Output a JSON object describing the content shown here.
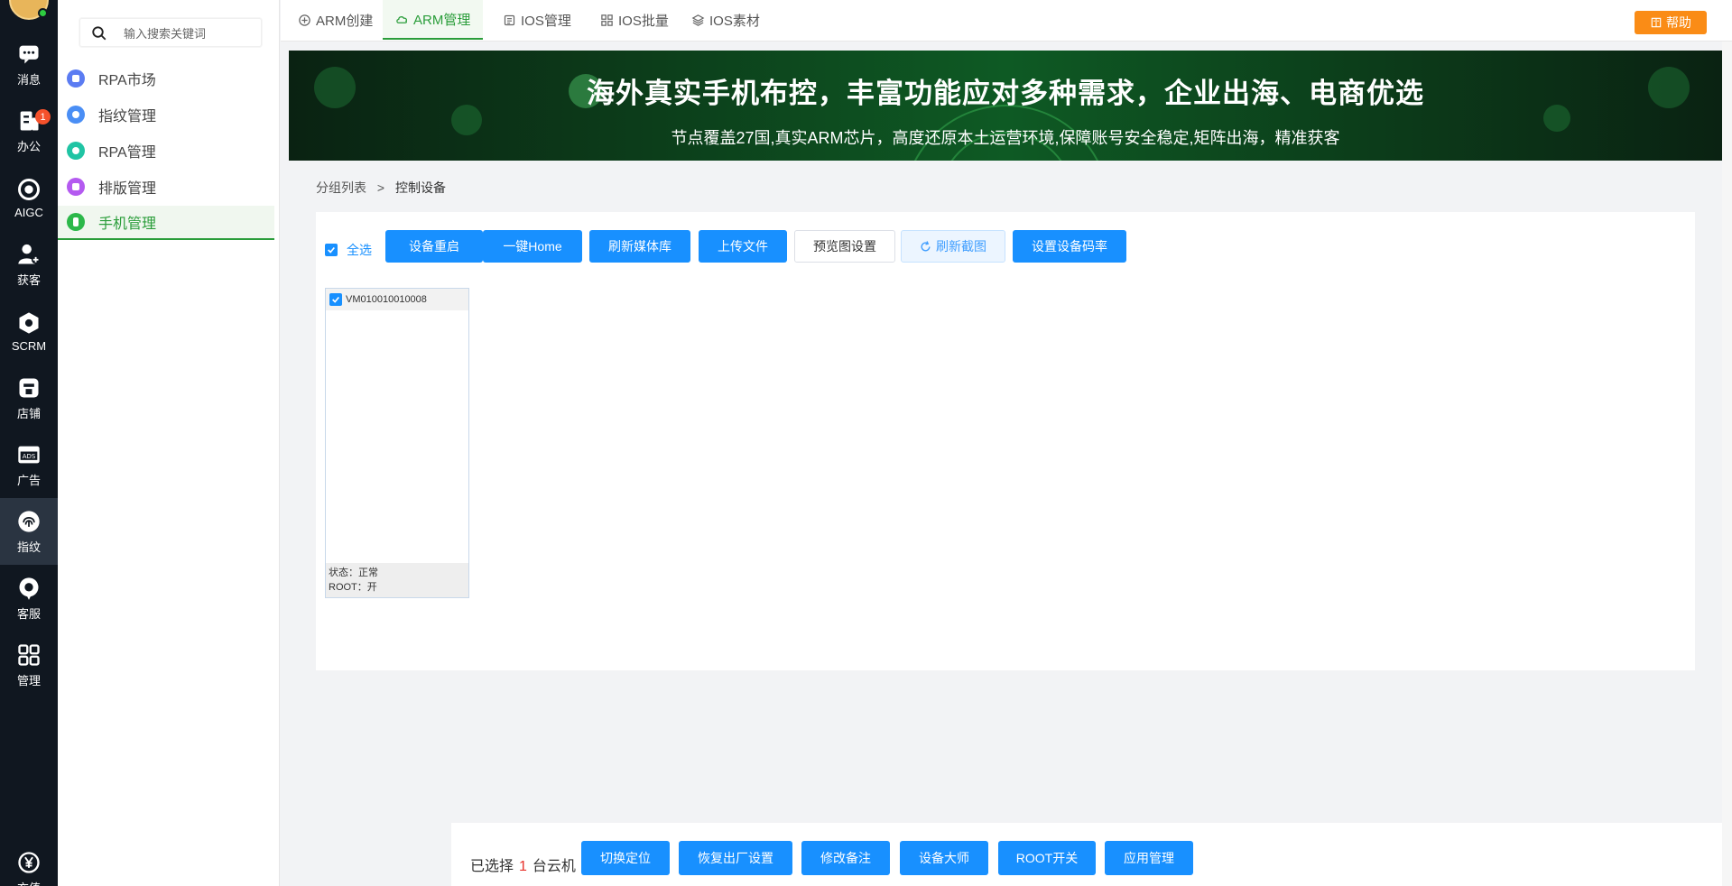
{
  "rail": {
    "items": [
      {
        "label": "消息",
        "icon": "chat-icon"
      },
      {
        "label": "办公",
        "icon": "office-icon",
        "badge": "1"
      },
      {
        "label": "AIGC",
        "icon": "aigc-icon"
      },
      {
        "label": "获客",
        "icon": "add-user-icon"
      },
      {
        "label": "SCRM",
        "icon": "scrm-icon"
      },
      {
        "label": "店铺",
        "icon": "shop-icon"
      },
      {
        "label": "广告",
        "icon": "ads-icon"
      },
      {
        "label": "指纹",
        "icon": "fingerprint-icon"
      },
      {
        "label": "客服",
        "icon": "support-icon"
      },
      {
        "label": "管理",
        "icon": "grid-icon"
      },
      {
        "label": "充值",
        "icon": "yen-icon"
      }
    ]
  },
  "sidebar": {
    "search_placeholder": "输入搜索关键词",
    "items": [
      {
        "label": "RPA市场",
        "color": "#5b7cf2"
      },
      {
        "label": "指纹管理",
        "color": "#4a8ef5"
      },
      {
        "label": "RPA管理",
        "color": "#20c4a4"
      },
      {
        "label": "排版管理",
        "color": "#b45af0"
      },
      {
        "label": "手机管理",
        "color": "#2cb84a"
      }
    ]
  },
  "tabs": [
    {
      "label": "ARM创建",
      "icon": "plus-circle-icon"
    },
    {
      "label": "ARM管理",
      "icon": "cloud-icon"
    },
    {
      "label": "IOS管理",
      "icon": "list-icon"
    },
    {
      "label": "IOS批量",
      "icon": "grid-icon"
    },
    {
      "label": "IOS素材",
      "icon": "layers-icon"
    }
  ],
  "help_label": "帮助",
  "banner": {
    "title": "海外真实手机布控，丰富功能应对多种需求，企业出海、电商优选",
    "subtitle": "节点覆盖27国,真实ARM芯片，高度还原本土运营环境,保障账号安全稳定,矩阵出海，精准获客"
  },
  "breadcrumb": {
    "parent": "分组列表",
    "sep": ">",
    "current": "控制设备"
  },
  "toolbar": {
    "select_all": "全选",
    "buttons": [
      "设备重启",
      "一键Home",
      "刷新媒体库",
      "上传文件",
      "预览图设置",
      "刷新截图",
      "设置设备码率"
    ]
  },
  "device": {
    "id": "VM010010010008",
    "status_label": "状态：",
    "status_value": "正常",
    "root_label": "ROOT：",
    "root_value": "开"
  },
  "bottom": {
    "prefix": "已选择",
    "count": "1",
    "suffix": "台云机",
    "buttons": [
      "切换定位",
      "恢复出厂设置",
      "修改备注",
      "设备大师",
      "ROOT开关",
      "应用管理"
    ]
  }
}
